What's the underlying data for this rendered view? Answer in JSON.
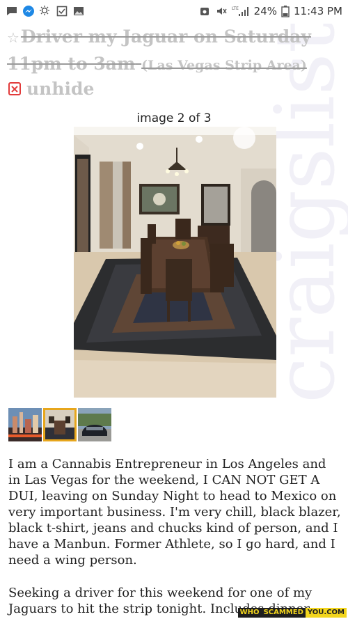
{
  "status_bar": {
    "battery": "24%",
    "time": "11:43 PM",
    "network": "LTE",
    "left_icons": [
      "message-icon",
      "messenger-icon",
      "weather-icon",
      "checkbox-icon",
      "image-icon"
    ],
    "right_icons": [
      "alarm-icon",
      "mute-icon",
      "signal-icon",
      "battery-icon"
    ]
  },
  "listing": {
    "title": "Driver my Jaguar on Saturday 11pm to 3am",
    "area": "(Las Vegas Strip Area)",
    "unhide_label": "unhide",
    "watermark": "craigslist"
  },
  "gallery": {
    "counter": "image 2 of 3",
    "thumbnails": [
      {
        "name": "thumbnail-1-vegas-strip",
        "selected": false
      },
      {
        "name": "thumbnail-2-dining-room",
        "selected": true
      },
      {
        "name": "thumbnail-3-jaguar-car",
        "selected": false
      }
    ]
  },
  "body": {
    "paragraph_1": "I am a Cannabis Entrepreneur in Los Angeles and in Las Vegas for the weekend, I CAN NOT GET A DUI, leaving on Sunday Night to head to Mexico on very important business. I'm very chill, black blazer, black t-shirt, jeans and chucks kind of person, and I have a Manbun. Former Athlete, so I go hard, and I need a wing person.",
    "paragraph_2": "Seeking a driver for this weekend for one of my Jaguars to hit the strip tonight. Includes dinner"
  },
  "badge": {
    "who": "WHO",
    "scammed": "SCAMMED",
    "you": "YOU.COM"
  },
  "colors": {
    "title_gray": "#c4c4c4",
    "delete_red": "#e23b3b",
    "thumb_selected": "#e7a61c",
    "text": "#222222"
  }
}
